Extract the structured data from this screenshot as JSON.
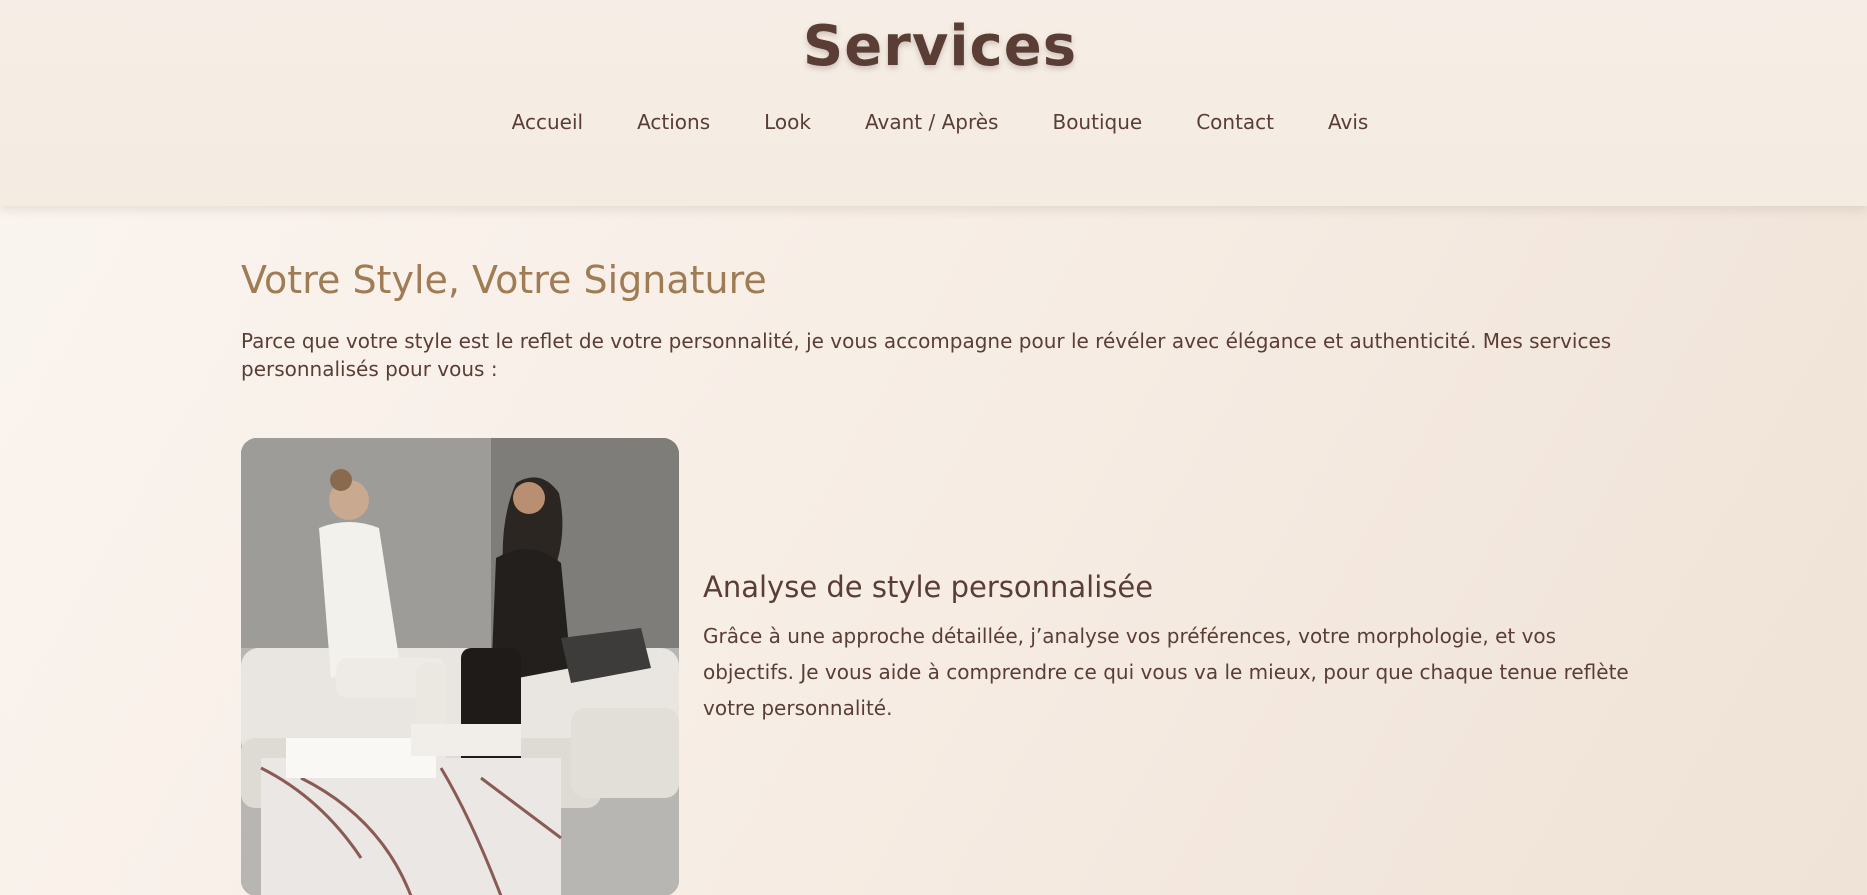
{
  "header": {
    "title": "Services",
    "nav": [
      "Accueil",
      "Actions",
      "Look",
      "Avant / Après",
      "Boutique",
      "Contact",
      "Avis"
    ]
  },
  "main": {
    "heading": "Votre Style, Votre Signature",
    "intro": "Parce que votre style est le reflet de votre personnalité, je vous accompagne pour le révéler avec élégance et authenticité. Mes services personnalisés pour vous :",
    "services": [
      {
        "title": "Analyse de style personnalisée",
        "description": "Grâce à une approche détaillée, j’analyse vos préférences, votre morphologie, et vos objectifs. Je vous aide à comprendre ce qui vous va le mieux, pour que chaque tenue reflète votre personnalité."
      }
    ]
  },
  "colors": {
    "text": "#5a3e36",
    "accent": "#a07c55",
    "background": "#f6ece3"
  }
}
